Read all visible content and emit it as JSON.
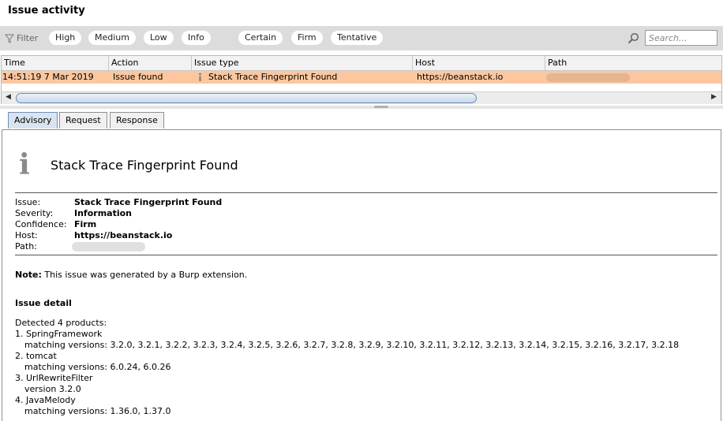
{
  "window_title": "Issue activity",
  "filter": {
    "label": "Filter",
    "severity_options": [
      "High",
      "Medium",
      "Low",
      "Info"
    ],
    "confidence_options": [
      "Certain",
      "Firm",
      "Tentative"
    ],
    "search_placeholder": "Search..."
  },
  "table": {
    "columns": [
      "Time",
      "Action",
      "Issue type",
      "Host",
      "Path"
    ],
    "rows": [
      {
        "time": "14:51:19 7 Mar 2019",
        "action": "Issue found",
        "issue_type": "Stack Trace Fingerprint Found",
        "host": "https://beanstack.io",
        "path": ""
      }
    ]
  },
  "tabs": [
    "Advisory",
    "Request",
    "Response"
  ],
  "advisory": {
    "title": "Stack Trace Fingerprint Found",
    "fields": [
      {
        "label": "Issue:",
        "value": "Stack Trace Fingerprint Found"
      },
      {
        "label": "Severity:",
        "value": "Information"
      },
      {
        "label": "Confidence:",
        "value": "Firm"
      },
      {
        "label": "Host:",
        "value": "https://beanstack.io"
      },
      {
        "label": "Path:",
        "value": ""
      }
    ],
    "note_label": "Note:",
    "note_text": " This issue was generated by a Burp extension.",
    "detail_heading": "Issue detail",
    "detail_lines": [
      "Detected 4 products:",
      "1. SpringFramework",
      "matching versions: 3.2.0, 3.2.1, 3.2.2, 3.2.3, 3.2.4, 3.2.5, 3.2.6, 3.2.7, 3.2.8, 3.2.9, 3.2.10, 3.2.11, 3.2.12, 3.2.13, 3.2.14, 3.2.15, 3.2.16, 3.2.17, 3.2.18",
      "2. tomcat",
      "matching versions: 6.0.24, 6.0.26",
      "3. UrlRewriteFilter",
      "version 3.2.0",
      "4. JavaMelody",
      "matching versions: 1.36.0, 1.37.0"
    ]
  },
  "colors": {
    "selected_row": "#fcc79f",
    "filter_bar": "#dcdcdc",
    "active_tab": "#d9e4f0"
  },
  "icons": [
    "filter-icon",
    "search-icon",
    "info-icon",
    "scroll-left-icon",
    "scroll-right-icon"
  ]
}
